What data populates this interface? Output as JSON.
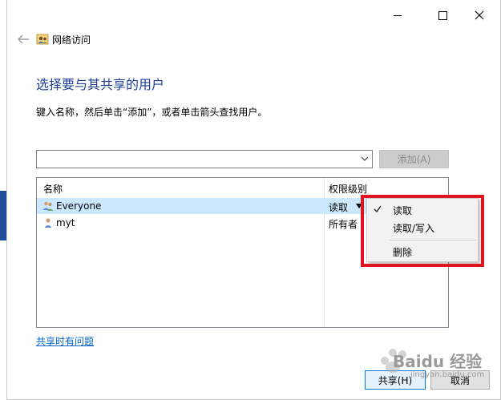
{
  "window": {
    "title": "网络访问"
  },
  "page": {
    "heading": "选择要与其共享的用户",
    "instruction": "键入名称，然后单击“添加”，或者单击箭头查找用户。"
  },
  "user_input": {
    "value": "",
    "placeholder": ""
  },
  "add_button": {
    "label": "添加(A)"
  },
  "list": {
    "columns": [
      "名称",
      "权限级别"
    ],
    "rows": [
      {
        "name": "Everyone",
        "permission": "读取",
        "icon": "group-users-icon",
        "selected": true
      },
      {
        "name": "myt",
        "permission": "所有者",
        "icon": "user-icon",
        "selected": false
      }
    ]
  },
  "context_menu": {
    "items": [
      {
        "label": "读取",
        "checked": true
      },
      {
        "label": "读取/写入",
        "checked": false
      },
      {
        "label": "删除",
        "checked": false
      }
    ]
  },
  "help_link": {
    "label": "共享时有问题"
  },
  "buttons": {
    "share": "共享(H)",
    "cancel": "取消"
  },
  "colors": {
    "heading": "#1e3d95",
    "selection": "#cce8ff",
    "annotation": "#e0141e",
    "link": "#0066cc"
  },
  "watermark": {
    "text": "Baidu 经验",
    "sub": "jingyan.baidu.com"
  }
}
